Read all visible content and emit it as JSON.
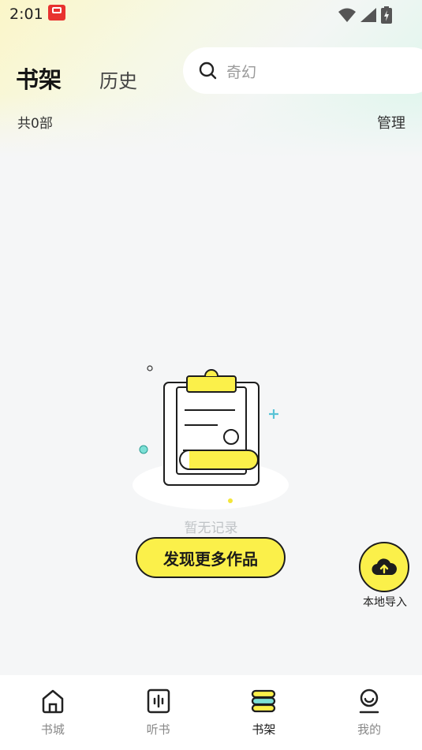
{
  "status_bar": {
    "time": "2:01"
  },
  "header": {
    "tabs": [
      {
        "label": "书架",
        "active": true
      },
      {
        "label": "历史",
        "active": false
      }
    ],
    "search": {
      "placeholder": "奇幻"
    }
  },
  "shelf": {
    "count_text": "共0部",
    "manage_label": "管理"
  },
  "empty_state": {
    "message": "暂无记录",
    "button_label": "发现更多作品"
  },
  "import": {
    "label": "本地导入"
  },
  "bottom_nav": {
    "items": [
      {
        "label": "书城",
        "icon": "home-icon",
        "active": false
      },
      {
        "label": "听书",
        "icon": "audio-icon",
        "active": false
      },
      {
        "label": "书架",
        "icon": "bookshelf-icon",
        "active": true
      },
      {
        "label": "我的",
        "icon": "profile-icon",
        "active": false
      }
    ]
  },
  "colors": {
    "accent": "#fbf04a",
    "text_dark": "#151515",
    "muted": "#888888"
  }
}
